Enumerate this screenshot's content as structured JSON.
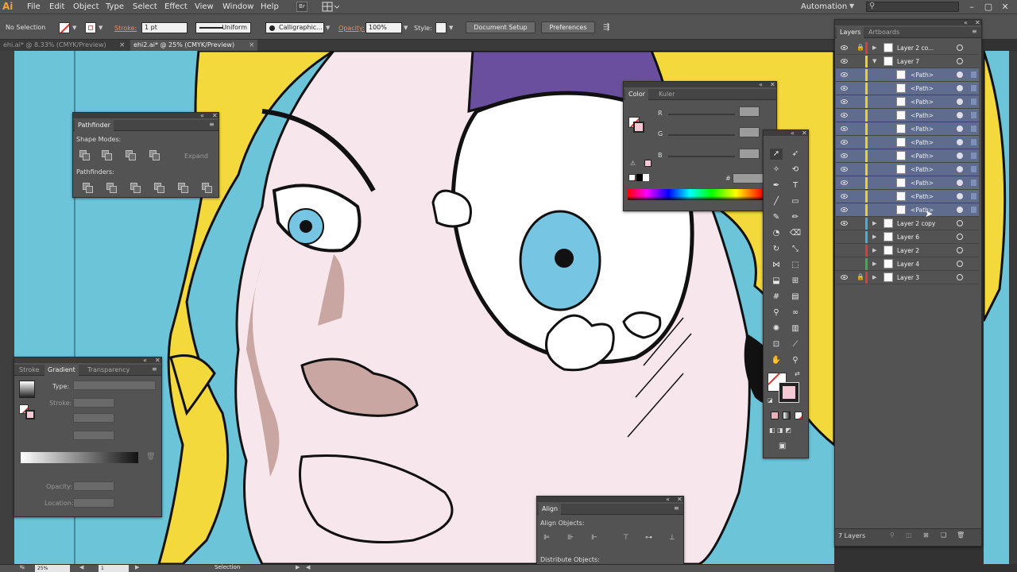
{
  "menubar": {
    "logo": "Ai",
    "items": [
      "File",
      "Edit",
      "Object",
      "Type",
      "Select",
      "Effect",
      "View",
      "Window",
      "Help"
    ],
    "bridge": "Br",
    "workspace": "Automation"
  },
  "controlbar": {
    "selection": "No Selection",
    "stroke_label": "Stroke:",
    "stroke_weight": "1 pt",
    "profile": "Uniform",
    "brush": "Calligraphic...",
    "opacity_label": "Opacity:",
    "opacity_value": "100%",
    "style_label": "Style:",
    "document_setup": "Document Setup",
    "preferences": "Preferences"
  },
  "tabs": [
    {
      "label": "ehi.ai* @ 8.33% (CMYK/Preview)",
      "active": false
    },
    {
      "label": "ehi2.ai* @ 25% (CMYK/Preview)",
      "active": true
    }
  ],
  "pathfinder": {
    "title": "Pathfinder",
    "shape_modes": "Shape Modes:",
    "expand": "Expand",
    "pathfinders": "Pathfinders:"
  },
  "gradient": {
    "tabs": [
      "Stroke",
      "Gradient",
      "Transparency"
    ],
    "type_label": "Type:",
    "stroke_label": "Stroke:",
    "opacity_label": "Opacity:",
    "location_label": "Location:"
  },
  "color_panel": {
    "tabs": [
      "Color",
      "Kuler"
    ],
    "channels": [
      "R",
      "G",
      "B"
    ],
    "hex_label": "#"
  },
  "align": {
    "title": "Align",
    "align_objects": "Align Objects:",
    "distribute_objects": "Distribute Objects:"
  },
  "layers": {
    "tabs": [
      "Layers",
      "Artboards"
    ],
    "rows": [
      {
        "name": "Layer 2 co...",
        "type": "layer",
        "color": "#e03a3a",
        "locked": true,
        "expanded": false,
        "visible": true
      },
      {
        "name": "Layer 7",
        "type": "layer",
        "color": "#f0d020",
        "locked": false,
        "expanded": true,
        "visible": true
      },
      {
        "name": "<Path>",
        "type": "path",
        "color": "#f0d020",
        "visible": true
      },
      {
        "name": "<Path>",
        "type": "path",
        "color": "#f0d020",
        "visible": true
      },
      {
        "name": "<Path>",
        "type": "path",
        "color": "#f0d020",
        "visible": true
      },
      {
        "name": "<Path>",
        "type": "path",
        "color": "#f0d020",
        "visible": true
      },
      {
        "name": "<Path>",
        "type": "path",
        "color": "#f0d020",
        "visible": true
      },
      {
        "name": "<Path>",
        "type": "path",
        "color": "#f0d020",
        "visible": true
      },
      {
        "name": "<Path>",
        "type": "path",
        "color": "#f0d020",
        "visible": true
      },
      {
        "name": "<Path>",
        "type": "path",
        "color": "#f0d020",
        "visible": true
      },
      {
        "name": "<Path>",
        "type": "path",
        "color": "#f0d020",
        "visible": true
      },
      {
        "name": "<Path>",
        "type": "path",
        "color": "#f0d020",
        "visible": true
      },
      {
        "name": "<Path>",
        "type": "path",
        "color": "#f0d020",
        "visible": true
      },
      {
        "name": "Layer 2 copy",
        "type": "layer",
        "color": "#40b0e0",
        "locked": false,
        "expanded": false,
        "visible": true
      },
      {
        "name": "Layer 6",
        "type": "layer",
        "color": "#40b0e0",
        "locked": false,
        "expanded": false,
        "visible": false
      },
      {
        "name": "Layer 2",
        "type": "layer",
        "color": "#e03a3a",
        "locked": false,
        "expanded": false,
        "visible": false
      },
      {
        "name": "Layer 4",
        "type": "layer",
        "color": "#3ab04a",
        "locked": false,
        "expanded": false,
        "visible": false
      },
      {
        "name": "Layer 3",
        "type": "layer",
        "color": "#e03a3a",
        "locked": true,
        "expanded": false,
        "visible": true
      }
    ],
    "count": "7 Layers"
  },
  "statusbar": {
    "zoom": "25%",
    "page": "1",
    "status": "Selection"
  },
  "colors": {
    "ui_dark": "#323232",
    "ui_panel": "#535353",
    "canvas_blue": "#6cc4d9",
    "skin": "#f7e6ec",
    "hair": "#f4d93c",
    "shadow": "#c9a6a1",
    "iris": "#76c5e3",
    "purple": "#6a4f9e",
    "selection_row": "#5f6c8e"
  }
}
